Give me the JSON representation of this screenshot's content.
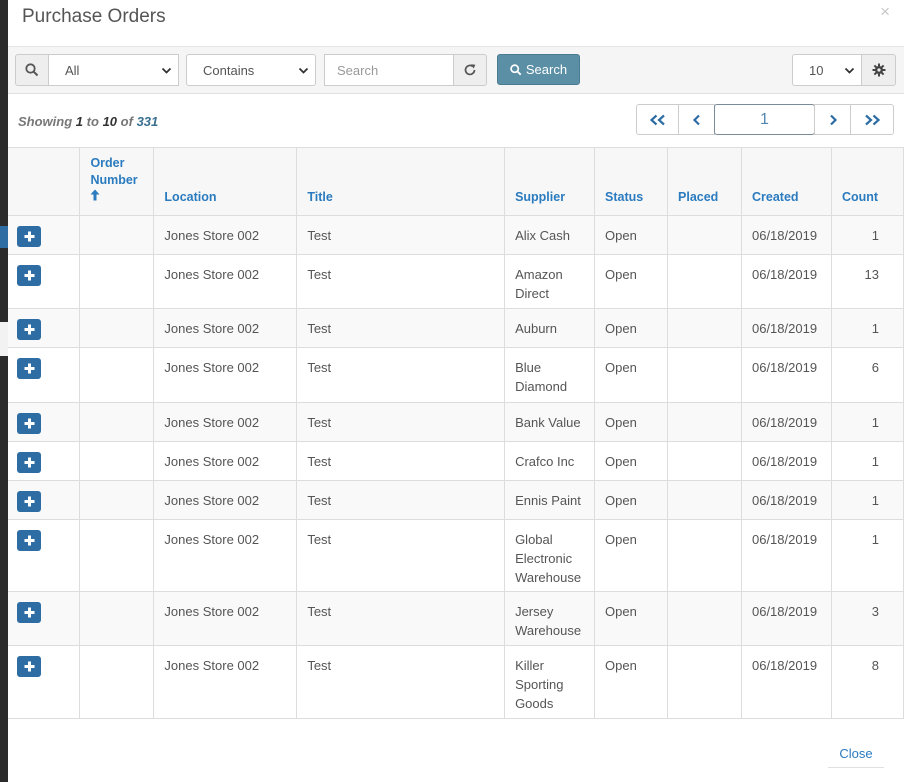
{
  "modal": {
    "title": "Purchase Orders",
    "close_icon": "×"
  },
  "toolbar": {
    "field_select": "All",
    "operator_select": "Contains",
    "search_placeholder": "Search",
    "search_button": "Search",
    "page_size": "10"
  },
  "summary": {
    "prefix": "Showing",
    "from": "1",
    "to_word": "to",
    "to": "10",
    "of_word": "of",
    "total": "331"
  },
  "pager": {
    "current_page": "1"
  },
  "table": {
    "headers": {
      "order_number": "Order Number",
      "location": "Location",
      "title": "Title",
      "supplier": "Supplier",
      "status": "Status",
      "placed": "Placed",
      "created": "Created",
      "count": "Count"
    },
    "rows": [
      {
        "order_number": "",
        "location": "Jones Store 002",
        "title": "Test",
        "supplier": "Alix Cash",
        "status": "Open",
        "placed": "",
        "created": "06/18/2019",
        "count": "1"
      },
      {
        "order_number": "",
        "location": "Jones Store 002",
        "title": "Test",
        "supplier": "Amazon Direct",
        "status": "Open",
        "placed": "",
        "created": "06/18/2019",
        "count": "13"
      },
      {
        "order_number": "",
        "location": "Jones Store 002",
        "title": "Test",
        "supplier": "Auburn",
        "status": "Open",
        "placed": "",
        "created": "06/18/2019",
        "count": "1"
      },
      {
        "order_number": "",
        "location": "Jones Store 002",
        "title": "Test",
        "supplier": "Blue Diamond",
        "status": "Open",
        "placed": "",
        "created": "06/18/2019",
        "count": "6"
      },
      {
        "order_number": "",
        "location": "Jones Store 002",
        "title": "Test",
        "supplier": "Bank Value",
        "status": "Open",
        "placed": "",
        "created": "06/18/2019",
        "count": "1"
      },
      {
        "order_number": "",
        "location": "Jones Store 002",
        "title": "Test",
        "supplier": "Crafco Inc",
        "status": "Open",
        "placed": "",
        "created": "06/18/2019",
        "count": "1"
      },
      {
        "order_number": "",
        "location": "Jones Store 002",
        "title": "Test",
        "supplier": "Ennis Paint",
        "status": "Open",
        "placed": "",
        "created": "06/18/2019",
        "count": "1"
      },
      {
        "order_number": "",
        "location": "Jones Store 002",
        "title": "Test",
        "supplier": "Global Electronic Warehouse",
        "status": "Open",
        "placed": "",
        "created": "06/18/2019",
        "count": "1"
      },
      {
        "order_number": "",
        "location": "Jones Store 002",
        "title": "Test",
        "supplier": "Jersey Warehouse",
        "status": "Open",
        "placed": "",
        "created": "06/18/2019",
        "count": "3"
      },
      {
        "order_number": "",
        "location": "Jones Store 002",
        "title": "Test",
        "supplier": "Killer Sporting Goods",
        "status": "Open",
        "placed": "",
        "created": "06/18/2019",
        "count": "8"
      }
    ]
  },
  "footer": {
    "close_label": "Close"
  },
  "colors": {
    "primary": "#2e6da4",
    "search_button": "#5b8fa5",
    "header_link": "#2a7bbf"
  },
  "icons": [
    "search-icon",
    "chevron-down-icon",
    "refresh-icon",
    "gear-icon",
    "sort-ascending-icon",
    "plus-icon",
    "double-chevron-left-icon",
    "chevron-left-icon",
    "chevron-right-icon",
    "double-chevron-right-icon"
  ]
}
